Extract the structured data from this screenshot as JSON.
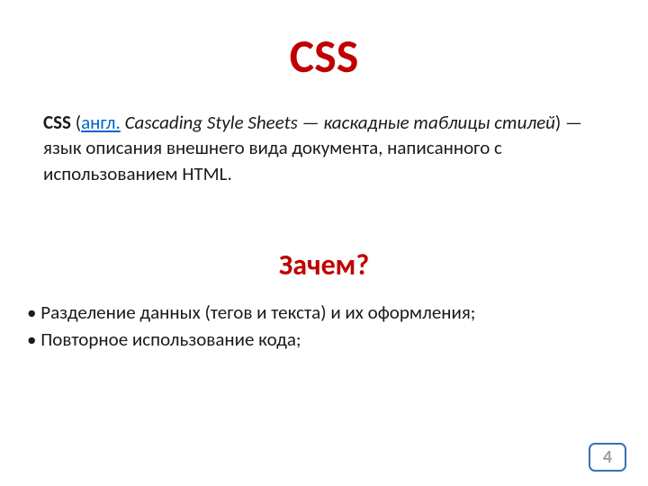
{
  "title": "CSS",
  "definition": {
    "abbr": "CSS",
    "open_paren": " (",
    "lang_link": "англ.",
    "expansion_italic": " Cascading Style Sheets — каскадные таблицы стилей",
    "close_paren": ")",
    "rest": " — язык описания внешнего вида документа, написанного с использованием HTML."
  },
  "subheading": "Зачем?",
  "bullets": [
    "Разделение данных (тегов и текста) и их оформления;",
    "Повторное использование кода;"
  ],
  "page_number": "4"
}
